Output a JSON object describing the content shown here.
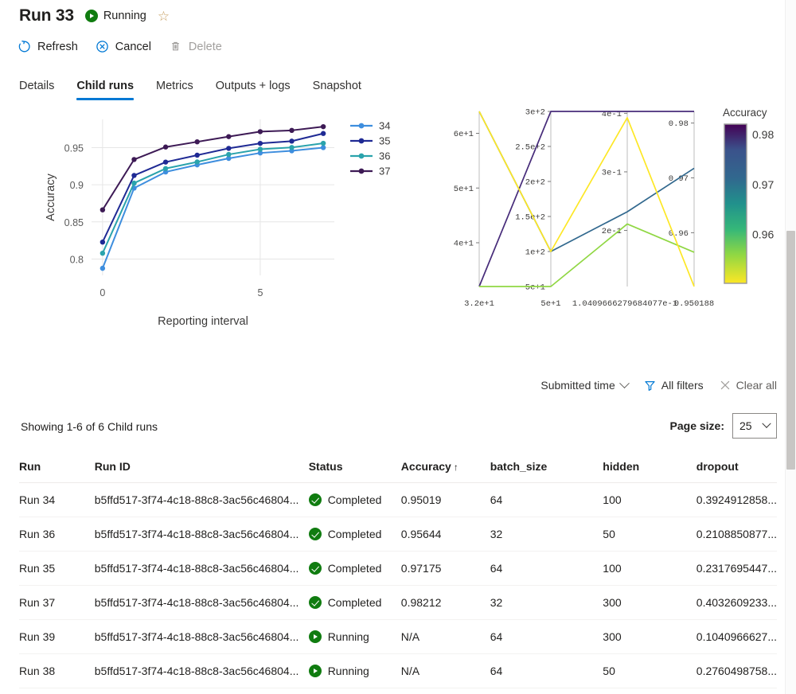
{
  "header": {
    "title": "Run 33",
    "status": "Running",
    "status_icon": "play-circle-icon",
    "favorite_icon": "star-outline-icon"
  },
  "commands": [
    {
      "label": "Refresh",
      "icon": "refresh-icon",
      "disabled": false
    },
    {
      "label": "Cancel",
      "icon": "cancel-circle-icon",
      "disabled": false
    },
    {
      "label": "Delete",
      "icon": "trash-icon",
      "disabled": true
    }
  ],
  "tabs": [
    {
      "label": "Details",
      "active": false
    },
    {
      "label": "Child runs",
      "active": true
    },
    {
      "label": "Metrics",
      "active": false
    },
    {
      "label": "Outputs + logs",
      "active": false
    },
    {
      "label": "Snapshot",
      "active": false
    }
  ],
  "filterbar": {
    "sort_label": "Submitted time",
    "sort_icon": "chevron-down-icon",
    "all_filters_label": "All filters",
    "all_filters_icon": "funnel-icon",
    "clear_all_label": "Clear all",
    "clear_all_icon": "close-x-icon"
  },
  "summary": {
    "count_text": "Showing 1-6 of 6 Child runs",
    "page_size_label": "Page size:",
    "page_size_value": "25",
    "page_size_options": [
      "25"
    ]
  },
  "table": {
    "columns": [
      "Run",
      "Run ID",
      "Status",
      "Accuracy",
      "batch_size",
      "hidden",
      "dropout"
    ],
    "sorted_column": "Accuracy",
    "sort_direction": "ascending",
    "sort_glyph": "↑",
    "rows": [
      {
        "run": "Run 34",
        "run_id": "b5ffd517-3f74-4c18-88c8-3ac56c46804...",
        "status": "Completed",
        "status_icon": "check-circle-icon",
        "accuracy": "0.95019",
        "batch_size": "64",
        "hidden": "100",
        "dropout": "0.3924912858..."
      },
      {
        "run": "Run 36",
        "run_id": "b5ffd517-3f74-4c18-88c8-3ac56c46804...",
        "status": "Completed",
        "status_icon": "check-circle-icon",
        "accuracy": "0.95644",
        "batch_size": "32",
        "hidden": "50",
        "dropout": "0.2108850877..."
      },
      {
        "run": "Run 35",
        "run_id": "b5ffd517-3f74-4c18-88c8-3ac56c46804...",
        "status": "Completed",
        "status_icon": "check-circle-icon",
        "accuracy": "0.97175",
        "batch_size": "64",
        "hidden": "100",
        "dropout": "0.2317695447..."
      },
      {
        "run": "Run 37",
        "run_id": "b5ffd517-3f74-4c18-88c8-3ac56c46804...",
        "status": "Completed",
        "status_icon": "check-circle-icon",
        "accuracy": "0.98212",
        "batch_size": "32",
        "hidden": "300",
        "dropout": "0.4032609233..."
      },
      {
        "run": "Run 39",
        "run_id": "b5ffd517-3f74-4c18-88c8-3ac56c46804...",
        "status": "Running",
        "status_icon": "play-circle-icon",
        "accuracy": "N/A",
        "batch_size": "64",
        "hidden": "300",
        "dropout": "0.1040966627..."
      },
      {
        "run": "Run 38",
        "run_id": "b5ffd517-3f74-4c18-88c8-3ac56c46804...",
        "status": "Running",
        "status_icon": "play-circle-icon",
        "accuracy": "N/A",
        "batch_size": "64",
        "hidden": "50",
        "dropout": "0.2760498758..."
      }
    ]
  },
  "chart_data": [
    {
      "id": "accuracy-line-chart",
      "type": "line",
      "title": "",
      "xlabel": "Reporting interval",
      "ylabel": "Accuracy",
      "x": [
        0,
        1,
        2,
        3,
        4,
        5,
        6,
        7
      ],
      "xticks": [
        "0",
        "5"
      ],
      "xtick_values": [
        0,
        5
      ],
      "yticks": [
        "0.8",
        "0.85",
        "0.9",
        "0.95"
      ],
      "ytick_values": [
        0.8,
        0.85,
        0.9,
        0.95
      ],
      "xlim": [
        -0.35,
        7.35
      ],
      "ylim": [
        0.778,
        0.988
      ],
      "grid": true,
      "legend_position": "right",
      "markers": true,
      "series": [
        {
          "name": "34",
          "color": "#3e8ede",
          "values": [
            0.7875,
            0.8955,
            0.9172,
            0.9268,
            0.9355,
            0.9428,
            0.9457,
            0.95
          ]
        },
        {
          "name": "35",
          "color": "#1f2a94",
          "values": [
            0.8228,
            0.9125,
            0.9305,
            0.9398,
            0.949,
            0.9557,
            0.9587,
            0.969
          ]
        },
        {
          "name": "36",
          "color": "#2aa3ac",
          "values": [
            0.8078,
            0.9022,
            0.9218,
            0.9307,
            0.9408,
            0.9478,
            0.9502,
            0.9558
          ]
        },
        {
          "name": "37",
          "color": "#3d1a55",
          "values": [
            0.8662,
            0.934,
            0.9508,
            0.9578,
            0.9648,
            0.9715,
            0.9732,
            0.9782
          ]
        }
      ]
    },
    {
      "id": "hyperparameter-parallel-coordinates",
      "type": "line",
      "subtype": "parallel-coordinates",
      "colorbar_title": "Accuracy",
      "colorbar_ticks": [
        "0.98",
        "0.97",
        "0.96"
      ],
      "colorbar_tick_values": [
        0.98,
        0.97,
        0.96
      ],
      "colorbar_range": [
        0.9502,
        0.9821
      ],
      "colorbar_colormap": "viridis-reversed",
      "axes": [
        {
          "name": "batch_size",
          "bottom_label": "3.2e+1",
          "ticks": [
            "6e+1",
            "5e+1",
            "4e+1"
          ],
          "tick_values": [
            60,
            50,
            40
          ],
          "range": [
            32,
            64
          ]
        },
        {
          "name": "hidden",
          "bottom_label": "5e+1",
          "ticks": [
            "3e+2",
            "2.5e+2",
            "2e+2",
            "1.5e+2",
            "1e+2",
            "5e+1"
          ],
          "tick_values": [
            300,
            250,
            200,
            150,
            100,
            50
          ],
          "range": [
            50,
            300
          ]
        },
        {
          "name": "dropout",
          "bottom_label": "1.0409666279684077e-1",
          "ticks": [
            "4e-1",
            "3e-1",
            "2e-1"
          ],
          "tick_values": [
            0.4,
            0.3,
            0.2
          ],
          "range": [
            0.10409666,
            0.40326092
          ]
        },
        {
          "name": "Accuracy",
          "bottom_label": "0.950188",
          "ticks": [
            "0.98",
            "0.97",
            "0.96"
          ],
          "tick_values": [
            0.98,
            0.97,
            0.96
          ],
          "range": [
            0.950188,
            0.98212
          ]
        }
      ],
      "lines": [
        {
          "name": "Run 37",
          "color": "#472c7a",
          "accuracy": 0.98212,
          "values": [
            32,
            300,
            0.4032609233,
            0.98212
          ]
        },
        {
          "name": "Run 35",
          "color": "#31688e",
          "accuracy": 0.97175,
          "values": [
            64,
            100,
            0.2317695447,
            0.97175
          ]
        },
        {
          "name": "Run 36",
          "color": "#90d743",
          "accuracy": 0.95644,
          "values": [
            32,
            50,
            0.2108850877,
            0.95644
          ]
        },
        {
          "name": "Run 34",
          "color": "#fde725",
          "accuracy": 0.95019,
          "values": [
            64,
            100,
            0.3924912858,
            0.95019
          ]
        }
      ]
    }
  ]
}
